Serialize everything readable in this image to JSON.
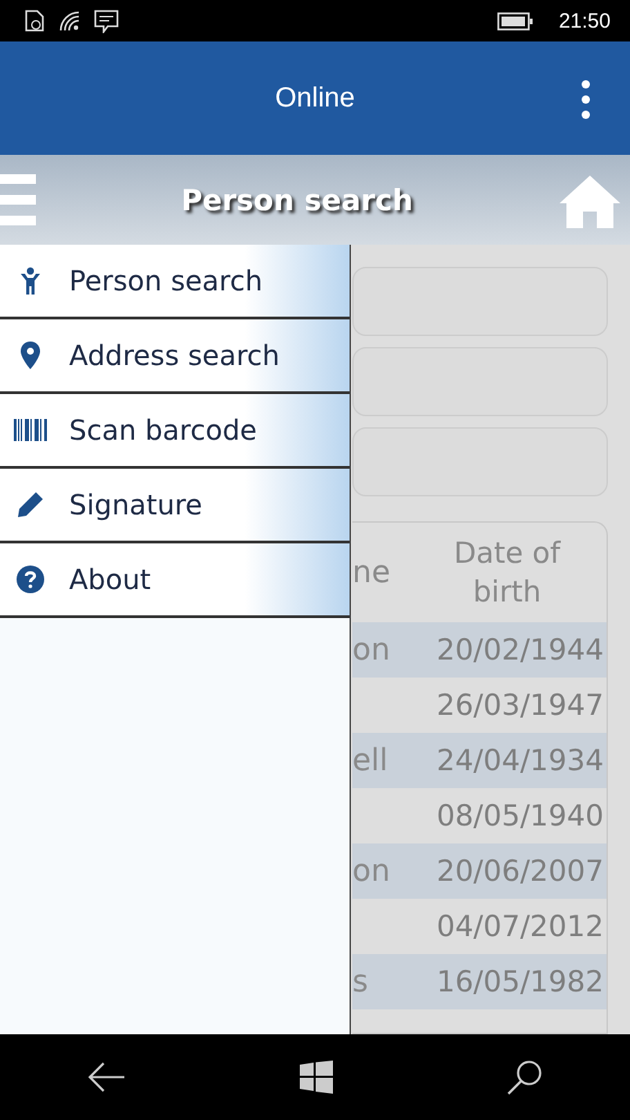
{
  "status_bar": {
    "time": "21:50"
  },
  "app_bar": {
    "title": "Online"
  },
  "header": {
    "title": "Person search"
  },
  "menu": {
    "items": [
      {
        "label": "Person search"
      },
      {
        "label": "Address search"
      },
      {
        "label": "Scan barcode"
      },
      {
        "label": "Signature"
      },
      {
        "label": "About"
      }
    ]
  },
  "table": {
    "columns": [
      {
        "label": "ne"
      },
      {
        "label": "Date of birth"
      }
    ],
    "rows": [
      {
        "column_1": "on",
        "column_2": "20/02/1944"
      },
      {
        "column_2": "26/03/1947"
      },
      {
        "column_1": "ell",
        "column_2": "24/04/1934"
      },
      {
        "column_2": "08/05/1940"
      },
      {
        "column_1": "on",
        "column_2": "20/06/2007"
      },
      {
        "column_2": "04/07/2012"
      },
      {
        "column_1": "s",
        "column_2": "16/05/1982"
      }
    ]
  }
}
